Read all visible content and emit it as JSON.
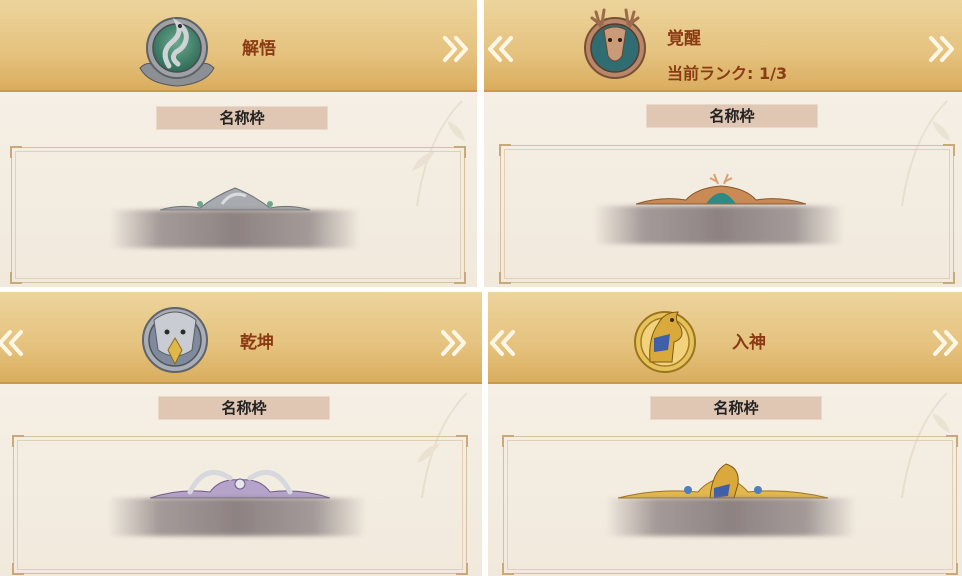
{
  "panels": [
    {
      "stage_name": "解悟",
      "rank_text": "",
      "section_label": "名称枠",
      "emblem_icon": "snake-emblem-icon",
      "show_prev": false,
      "show_next": true
    },
    {
      "stage_name": "覚醒",
      "rank_text": "当前ランク: 1/3",
      "section_label": "名称枠",
      "emblem_icon": "deer-emblem-icon",
      "show_prev": true,
      "show_next": true
    },
    {
      "stage_name": "乾坤",
      "rank_text": "",
      "section_label": "名称枠",
      "emblem_icon": "eagle-emblem-icon",
      "show_prev": true,
      "show_next": true
    },
    {
      "stage_name": "入神",
      "rank_text": "",
      "section_label": "名称枠",
      "emblem_icon": "horse-emblem-icon",
      "show_prev": true,
      "show_next": true
    }
  ],
  "colors": {
    "header_gold": "#e5c27e",
    "title_red": "#8a3b14",
    "label_bg": "#e0c7b4",
    "arrow_cream": "#fff7e6"
  }
}
